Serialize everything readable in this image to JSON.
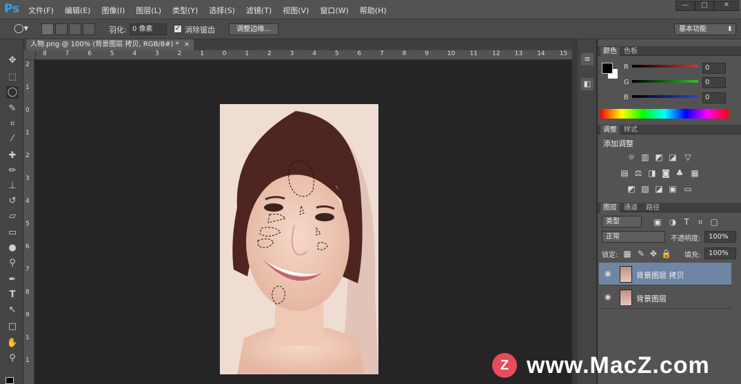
{
  "app": {
    "logo": "Ps"
  },
  "menu": [
    "文件(F)",
    "编辑(E)",
    "图像(I)",
    "图层(L)",
    "类型(Y)",
    "选择(S)",
    "滤镜(T)",
    "视图(V)",
    "窗口(W)",
    "帮助(H)"
  ],
  "window_buttons": [
    "—",
    "□",
    "✕"
  ],
  "options": {
    "feather_label": "羽化:",
    "feather_value": "0 像素",
    "antialias_label": "消除锯齿",
    "refine_button": "调整边缘...",
    "workspace": "基本功能"
  },
  "document_tab": {
    "title": "人物.png @ 100% (背景图层 拷贝, RGB/8#) *",
    "close": "×"
  },
  "ruler_top": [
    "8",
    "7",
    "6",
    "5",
    "4",
    "3",
    "2",
    "1",
    "0",
    "1",
    "2",
    "3",
    "4",
    "5",
    "6",
    "7",
    "8",
    "9",
    "10",
    "11",
    "12",
    "13",
    "14",
    "15"
  ],
  "ruler_left": [
    "2",
    "1",
    "0",
    "1",
    "2",
    "3",
    "4",
    "5",
    "6",
    "7",
    "8",
    "9",
    "1",
    "1"
  ],
  "color_panel": {
    "tabs": [
      "颜色",
      "色板"
    ],
    "channels": [
      {
        "label": "R",
        "value": "0",
        "color": "#e03030"
      },
      {
        "label": "G",
        "value": "0",
        "color": "#30c030"
      },
      {
        "label": "B",
        "value": "0",
        "color": "#3040e0"
      }
    ]
  },
  "adjust_panel": {
    "tabs": [
      "调整",
      "样式"
    ],
    "title": "添加调整"
  },
  "layers_panel": {
    "tabs": [
      "图层",
      "通道",
      "路径"
    ],
    "filter": "类型",
    "blend_mode": "正常",
    "opacity_label": "不透明度:",
    "opacity_value": "100%",
    "lock_label": "锁定:",
    "fill_label": "填充:",
    "fill_value": "100%",
    "layers": [
      {
        "name": "背景图层 拷贝",
        "selected": true
      },
      {
        "name": "背景图层",
        "selected": false
      }
    ]
  },
  "watermark": {
    "logo": "Z",
    "text": "www.MacZ.com"
  }
}
